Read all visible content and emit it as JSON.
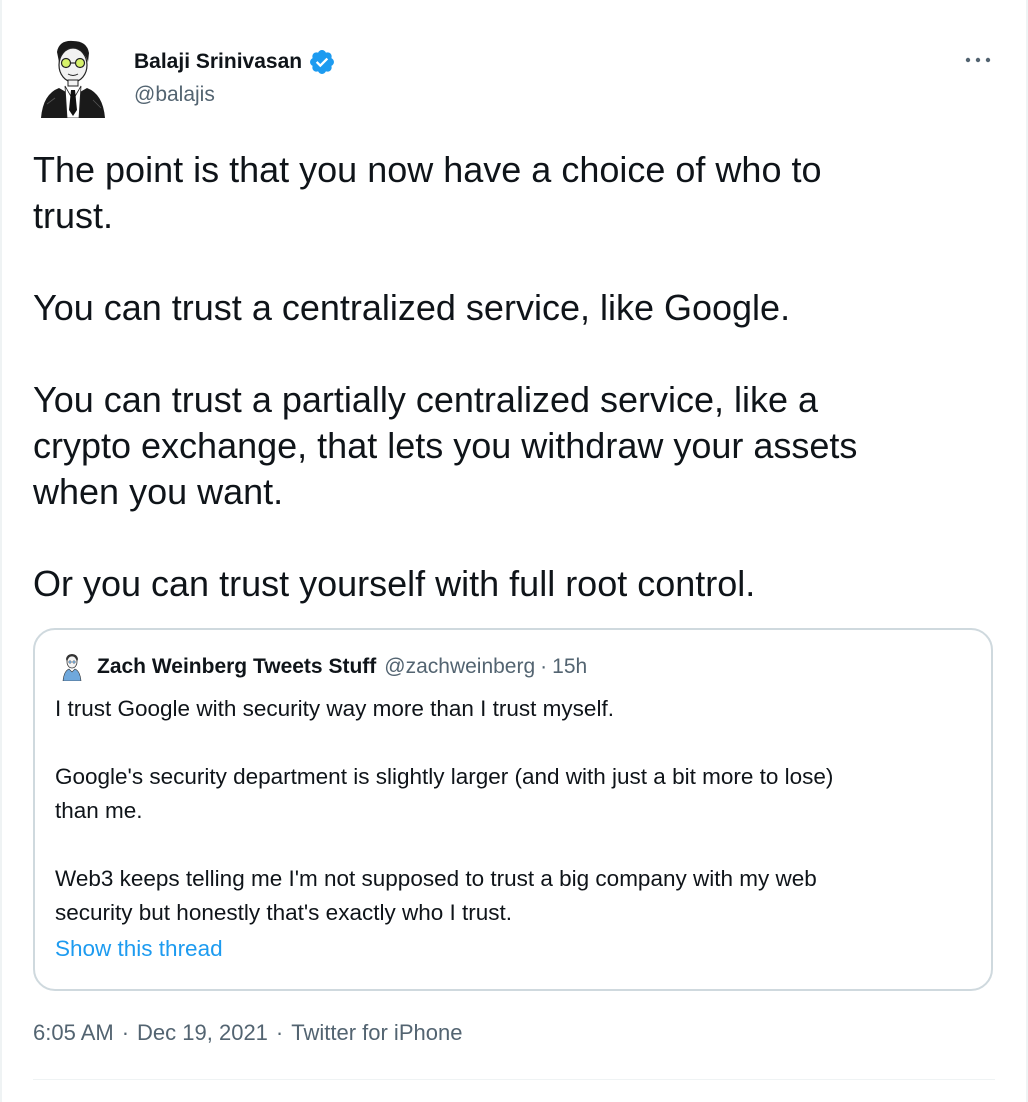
{
  "author": {
    "name": "Balaji Srinivasan",
    "handle": "@balajis",
    "verified": true,
    "avatar_icon": "sketch-portrait-avatar"
  },
  "more_icon": "ellipsis-icon",
  "tweet": {
    "text": "The point is that you now have a choice of who to\ntrust.\n\nYou can trust a centralized service, like Google.\n\nYou can trust a partially centralized service, like a\ncrypto exchange, that lets you withdraw your assets\nwhen you want.\n\nOr you can trust yourself with full root control."
  },
  "quote": {
    "name": "Zach Weinberg Tweets Stuff",
    "handle": "@zachweinberg",
    "separator": "·",
    "time": "15h",
    "text": "I trust Google with security way more than I trust myself.\n\nGoogle's security department is slightly larger (and with just a bit more to lose)\nthan me.\n\nWeb3 keeps telling me I'm not supposed to trust a big company with my web\nsecurity but honestly that's exactly who I trust.",
    "show_thread": "Show this thread"
  },
  "meta": {
    "time": "6:05 AM",
    "date": "Dec 19, 2021",
    "source": "Twitter for iPhone",
    "separator": "·"
  },
  "colors": {
    "text": "#0f1419",
    "secondary": "#536471",
    "link": "#1d9bf0",
    "border": "#cfd9de",
    "verified": "#1d9bf0"
  }
}
